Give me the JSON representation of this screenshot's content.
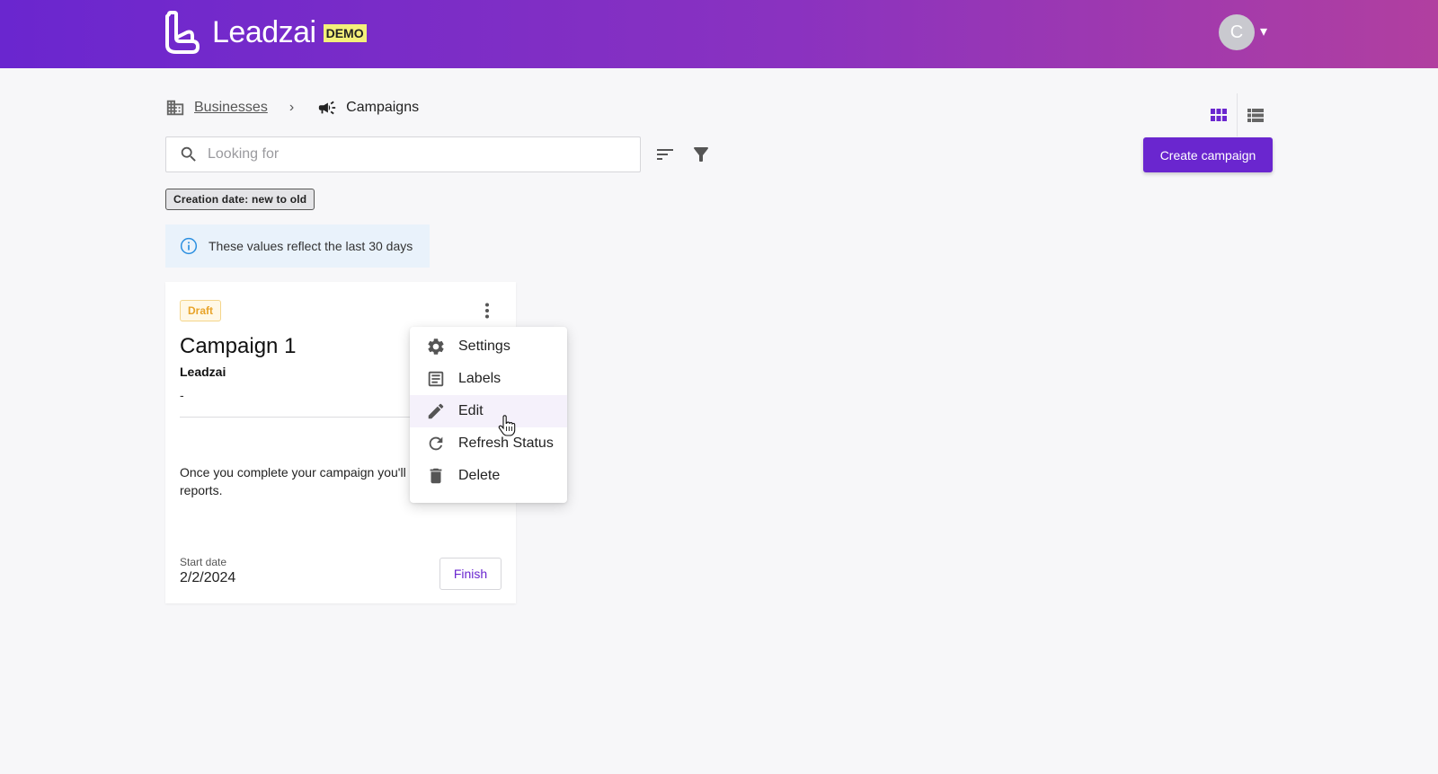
{
  "header": {
    "brand": "Leadzai",
    "badge": "DEMO",
    "avatar_initial": "C",
    "avatar_caret": "▾",
    "colors": {
      "gradient_start": "#6a26cf",
      "gradient_end": "#b13fa0"
    }
  },
  "breadcrumb": {
    "businesses_label": "Businesses",
    "separator": "›",
    "current_label": "Campaigns"
  },
  "toolbar": {
    "search_placeholder": "Looking for",
    "search_value": "",
    "create_label": "Create campaign",
    "active_sort_chip": "Creation date: new to old"
  },
  "info": {
    "text": "These values reflect the last 30 days"
  },
  "campaign_card": {
    "status": "Draft",
    "title": "Campaign 1",
    "business": "Leadzai",
    "detail": "-",
    "message": "Once you complete your campaign you'll",
    "message_line2": "reports.",
    "start_label": "Start date",
    "start_value": "2/2/2024",
    "finish_label": "Finish"
  },
  "menu": {
    "items": [
      {
        "label": "Settings",
        "icon": "gear-icon"
      },
      {
        "label": "Labels",
        "icon": "document-icon"
      },
      {
        "label": "Edit",
        "icon": "pencil-icon"
      },
      {
        "label": "Refresh Status",
        "icon": "refresh-icon"
      },
      {
        "label": "Delete",
        "icon": "trash-icon"
      }
    ],
    "hovered": "Edit"
  },
  "accent_color": "#6a26cf"
}
